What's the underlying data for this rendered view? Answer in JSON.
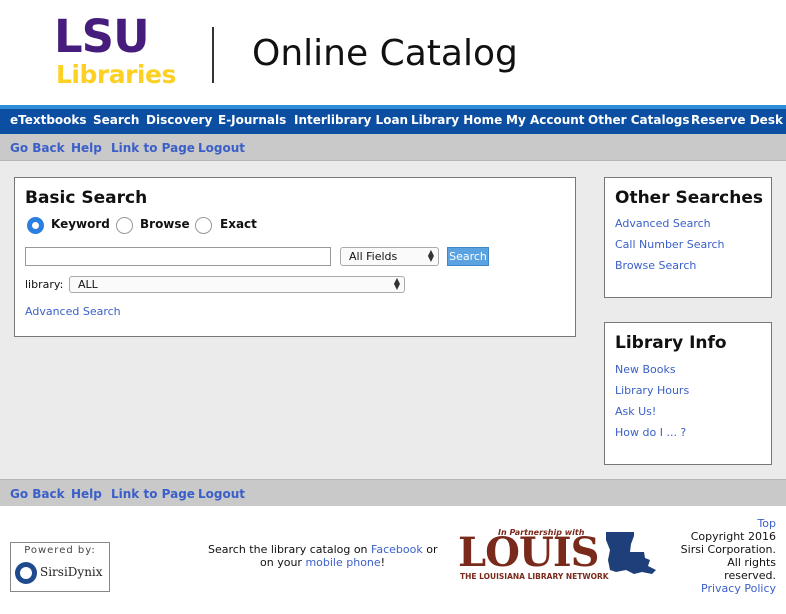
{
  "header": {
    "logo_primary": "LSU",
    "logo_secondary": "Libraries",
    "title": "Online Catalog"
  },
  "nav": {
    "items": [
      "eTextbooks",
      "Search",
      "Discovery",
      "E-Journals",
      "Interlibrary Loan",
      "Library Home",
      "My Account",
      "Other Catalogs",
      "Reserve Desk"
    ]
  },
  "subnav": {
    "links": [
      "Go Back",
      "Help",
      "Link to Page",
      "Logout"
    ]
  },
  "basic_search": {
    "title": "Basic Search",
    "modes": [
      "Keyword",
      "Browse",
      "Exact"
    ],
    "selected_mode": "Keyword",
    "query": "",
    "field_select": "All Fields",
    "search_button": "Search",
    "library_label": "library:",
    "library_select": "ALL",
    "advanced_link": "Advanced Search"
  },
  "other_searches": {
    "title": "Other Searches",
    "links": [
      "Advanced Search",
      "Call Number Search",
      "Browse Search"
    ]
  },
  "library_info": {
    "title": "Library Info",
    "links": [
      "New Books",
      "Library Hours",
      "Ask Us!",
      "How do I ... ?"
    ]
  },
  "footer": {
    "powered_by": "Powered by:",
    "powered_name": "SirsiDynix",
    "social_text_1": "Search the library catalog on",
    "facebook_link": "Facebook",
    "social_text_2": "or",
    "social_text_3": "on your",
    "mobile_link": "mobile phone",
    "social_text_4": "!",
    "louis_top": "In Partnership with",
    "louis_word": "LOUIS",
    "louis_bottom": "THE LOUISIANA LIBRARY NETWORK",
    "top_link": "Top",
    "copyright_lines": [
      "Copyright 2016",
      "Sirsi Corporation.",
      "All rights",
      "reserved."
    ],
    "privacy_link": "Privacy Policy"
  },
  "colors": {
    "lsu_purple": "#461d7c",
    "lsu_gold": "#fdd023",
    "nav_blue": "#0b4ea2",
    "link_blue": "#3a5fc8",
    "louis_brown": "#7a2a1a"
  }
}
